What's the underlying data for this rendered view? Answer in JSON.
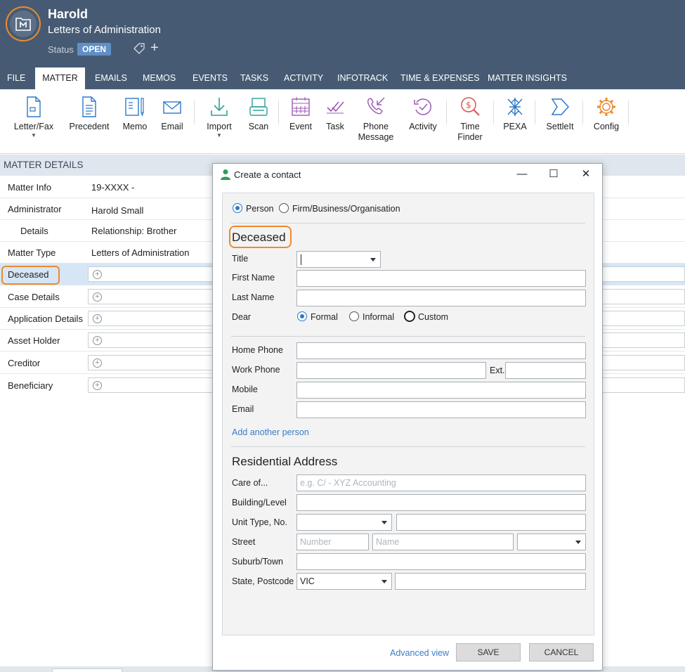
{
  "header": {
    "client_name": "Harold",
    "matter_title": "Letters of Administration",
    "status_label": "Status",
    "status_value": "OPEN"
  },
  "colors": {
    "header_bg": "#465b73",
    "accent_orange": "#f08a2c",
    "status_badge": "#5f8fc6",
    "link_blue": "#3b7cc4",
    "ribbon_icon_blue": "#2d78c8",
    "ribbon_icon_teal": "#2aa197",
    "ribbon_icon_purple": "#9b59b6",
    "ribbon_icon_red": "#d9534f"
  },
  "tabs": [
    "FILE",
    "MATTER",
    "EMAILS",
    "MEMOS",
    "EVENTS",
    "TASKS",
    "ACTIVITY",
    "INFOTRACK",
    "TIME & EXPENSES",
    "MATTER INSIGHTS"
  ],
  "active_tab": "MATTER",
  "ribbon": [
    {
      "label": "Letter/Fax",
      "icon": "letter-icon",
      "dropdown": true
    },
    {
      "label": "Precedent",
      "icon": "precedent-icon"
    },
    {
      "label": "Memo",
      "icon": "memo-icon"
    },
    {
      "label": "Email",
      "icon": "email-icon"
    },
    {
      "label": "Import",
      "icon": "import-icon",
      "dropdown": true
    },
    {
      "label": "Scan",
      "icon": "scan-icon"
    },
    {
      "label": "Event",
      "icon": "calendar-icon"
    },
    {
      "label": "Task",
      "icon": "task-icon"
    },
    {
      "label": "Phone\nMessage",
      "icon": "phone-message-icon"
    },
    {
      "label": "Activity",
      "icon": "activity-icon"
    },
    {
      "label": "Time\nFinder",
      "icon": "time-finder-icon"
    },
    {
      "label": "PEXA",
      "icon": "pexa-icon"
    },
    {
      "label": "SettleIt",
      "icon": "settleit-icon"
    },
    {
      "label": "Config",
      "icon": "gear-icon"
    }
  ],
  "matter_details": {
    "title": "MATTER DETAILS",
    "rows": [
      {
        "label": "Matter Info",
        "value": "19-XXXX -"
      },
      {
        "label": "Administrator",
        "value": "Harold Small"
      },
      {
        "label": "Details",
        "value": "Relationship: Brother"
      },
      {
        "label": "Matter Type",
        "value": "Letters of Administration"
      },
      {
        "label": "Deceased",
        "value": ""
      },
      {
        "label": "Case Details",
        "value": ""
      },
      {
        "label": "Application Details",
        "value": ""
      },
      {
        "label": "Asset Holder",
        "value": ""
      },
      {
        "label": "Creditor",
        "value": ""
      },
      {
        "label": "Beneficiary",
        "value": ""
      }
    ]
  },
  "dialog": {
    "title": "Create a contact",
    "type_options": [
      "Person",
      "Firm/Business/Organisation"
    ],
    "type_selected": "Person",
    "section_deceased": "Deceased",
    "fields": {
      "title": "Title",
      "first_name": "First Name",
      "last_name": "Last Name",
      "dear": "Dear",
      "home_phone": "Home Phone",
      "work_phone": "Work Phone",
      "ext": "Ext.",
      "mobile": "Mobile",
      "email": "Email"
    },
    "dear_options": [
      "Formal",
      "Informal",
      "Custom"
    ],
    "dear_selected": "Formal",
    "add_another": "Add another person",
    "section_address": "Residential Address",
    "address_fields": {
      "care_of": "Care of...",
      "care_of_placeholder": "e.g. C/ - XYZ Accounting",
      "building": "Building/Level",
      "unit": "Unit Type, No.",
      "street": "Street",
      "street_number_placeholder": "Number",
      "street_name_placeholder": "Name",
      "suburb": "Suburb/Town",
      "state_postcode": "State, Postcode",
      "state_value": "VIC"
    },
    "advanced_view": "Advanced view",
    "save": "SAVE",
    "cancel": "CANCEL"
  }
}
